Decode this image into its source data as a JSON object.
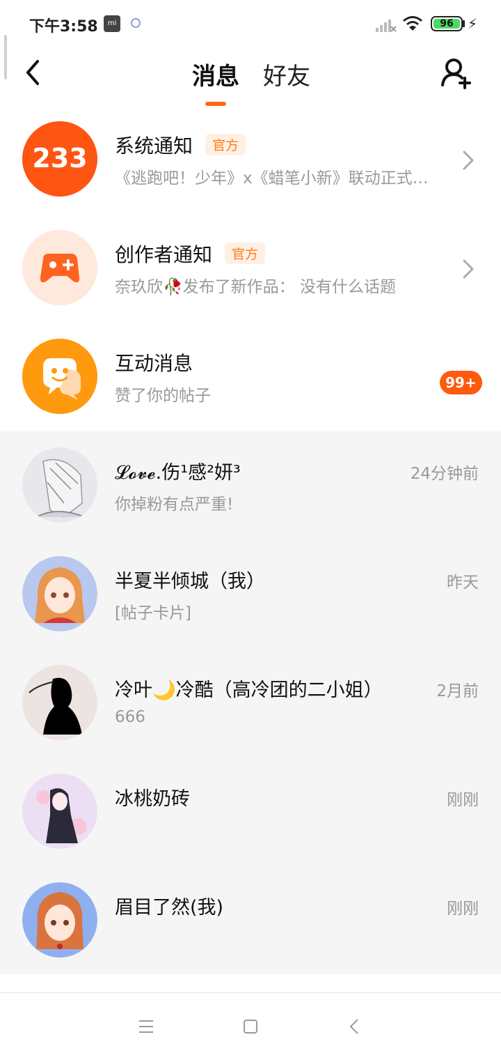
{
  "status_bar": {
    "time": "下午3:58",
    "mi_label": "mi",
    "battery": "96",
    "icons": [
      "mi-icon",
      "circle-notification-icon",
      "signal-icon",
      "wifi-icon",
      "battery-icon",
      "charging-icon"
    ]
  },
  "header": {
    "tabs": [
      {
        "label": "消息",
        "active": true
      },
      {
        "label": "好友",
        "active": false
      }
    ],
    "accent_color": "#ff6a12"
  },
  "official": [
    {
      "title": "系统通知",
      "tag": "官方",
      "subtitle": "《逃跑吧！少年》x《蜡笔小新》联动正式上线",
      "avatar_text": "233",
      "icon": "233-logo-icon"
    },
    {
      "title": "创作者通知",
      "tag": "官方",
      "subtitle": "奈玖欣🥀发布了新作品：  没有什么话题",
      "icon": "gamepad-plus-icon"
    },
    {
      "title": "互动消息",
      "subtitle": "赞了你的帖子",
      "badge": "99+",
      "icon": "chat-smile-icon"
    }
  ],
  "chats": [
    {
      "name": "𝓛𝓸𝓿𝓮.伤¹感²妍³",
      "message": "你掉粉有点严重!",
      "time": "24分钟前"
    },
    {
      "name": "半夏半倾城（我）",
      "message": "[帖子卡片]",
      "time": "昨天"
    },
    {
      "name": "冷叶🌙冷酷（高冷团的二小姐）",
      "message": "666",
      "time": "2月前"
    },
    {
      "name": "冰桃奶砖",
      "message": "",
      "time": "刚刚"
    },
    {
      "name": "眉目了然(我)",
      "message": "",
      "time": "刚刚"
    }
  ]
}
